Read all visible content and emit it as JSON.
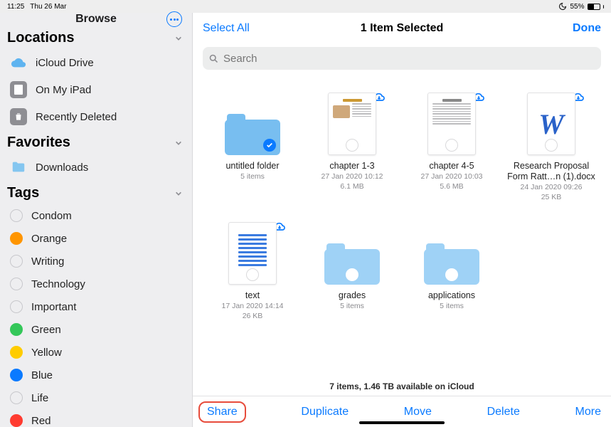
{
  "status": {
    "time": "11:25",
    "date": "Thu 26 Mar",
    "battery_pct": "55%"
  },
  "sidebar": {
    "title": "Browse",
    "locations_label": "Locations",
    "locations": [
      {
        "label": "iCloud Drive"
      },
      {
        "label": "On My iPad"
      },
      {
        "label": "Recently Deleted"
      }
    ],
    "favorites_label": "Favorites",
    "favorites": [
      {
        "label": "Downloads"
      }
    ],
    "tags_label": "Tags",
    "tags": [
      {
        "label": "Condom",
        "color": "open"
      },
      {
        "label": "Orange",
        "color": "#ff9500"
      },
      {
        "label": "Writing",
        "color": "open"
      },
      {
        "label": "Technology",
        "color": "open"
      },
      {
        "label": "Important",
        "color": "open"
      },
      {
        "label": "Green",
        "color": "#34c759"
      },
      {
        "label": "Yellow",
        "color": "#ffcc00"
      },
      {
        "label": "Blue",
        "color": "#0a7aff"
      },
      {
        "label": "Life",
        "color": "open"
      },
      {
        "label": "Red",
        "color": "#ff3b30"
      }
    ]
  },
  "header": {
    "select_all": "Select All",
    "title": "1 Item Selected",
    "done": "Done"
  },
  "search": {
    "placeholder": "Search"
  },
  "items": [
    {
      "name": "untitled folder",
      "meta1": "5 items",
      "meta2": ""
    },
    {
      "name": "chapter 1-3",
      "meta1": "27 Jan 2020 10:12",
      "meta2": "6.1 MB"
    },
    {
      "name": "chapter 4-5",
      "meta1": "27 Jan 2020 10:03",
      "meta2": "5.6 MB"
    },
    {
      "name": "Research Proposal Form Ratt…n (1).docx",
      "meta1": "24 Jan 2020 09:26",
      "meta2": "25 KB"
    },
    {
      "name": "text",
      "meta1": "17 Jan 2020 14:14",
      "meta2": "26 KB"
    },
    {
      "name": "grades",
      "meta1": "5 items",
      "meta2": ""
    },
    {
      "name": "applications",
      "meta1": "5 items",
      "meta2": ""
    }
  ],
  "footer": {
    "status": "7 items, 1.46 TB available on iCloud"
  },
  "toolbar": {
    "share": "Share",
    "duplicate": "Duplicate",
    "move": "Move",
    "delete": "Delete",
    "more": "More"
  }
}
